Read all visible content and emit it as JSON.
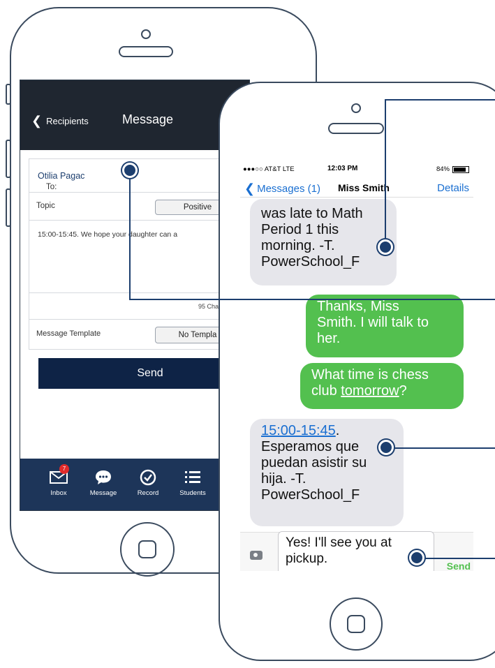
{
  "left_app": {
    "nav": {
      "back_label": "Recipients",
      "title": "Message"
    },
    "to_label": "To:",
    "to_value": "Otilia Pagac",
    "topic_label": "Topic",
    "topic_value": "Positive",
    "message_text": "15:00-15:45. We hope your daughter can a",
    "char_count": "95 Characters re",
    "template_label": "Message Template",
    "template_value": "No Templa",
    "send_label": "Send",
    "tabs": [
      {
        "label": "Inbox",
        "icon": "envelope-icon",
        "badge": "7"
      },
      {
        "label": "Message",
        "icon": "chat-bubble-icon"
      },
      {
        "label": "Record",
        "icon": "check-circle-icon"
      },
      {
        "label": "Students",
        "icon": "list-icon"
      }
    ]
  },
  "right_app": {
    "status": {
      "carrier": "●●●○○ AT&T  LTE",
      "time": "12:03 PM",
      "battery": "84%"
    },
    "nav": {
      "back_label": "Messages (1)",
      "contact": "Miss Smith",
      "details": "Details"
    },
    "messages": [
      {
        "direction": "incoming",
        "text": "was late to Math\nPeriod 1 this\nmorning. -T.\nPowerSchool_F"
      },
      {
        "direction": "outgoing",
        "text": "Thanks, Miss\nSmith. I will talk to\nher."
      },
      {
        "direction": "outgoing",
        "text_before": "What time is chess\nclub ",
        "link": "tomorrow",
        "text_after": "?"
      },
      {
        "direction": "incoming",
        "link": "15:00-15:45",
        "text_after": ".\nEsperamos que\npuedan asistir su\nhija. -T.\nPowerSchool_F"
      }
    ],
    "input_text": "Yes! I'll see you at\npickup.",
    "send_label": "Send"
  },
  "colors": {
    "navy": "#1c3e6e",
    "imessage_green": "#53c04f",
    "ios_blue": "#1a6fd1",
    "tabbar": "#1d3559"
  }
}
